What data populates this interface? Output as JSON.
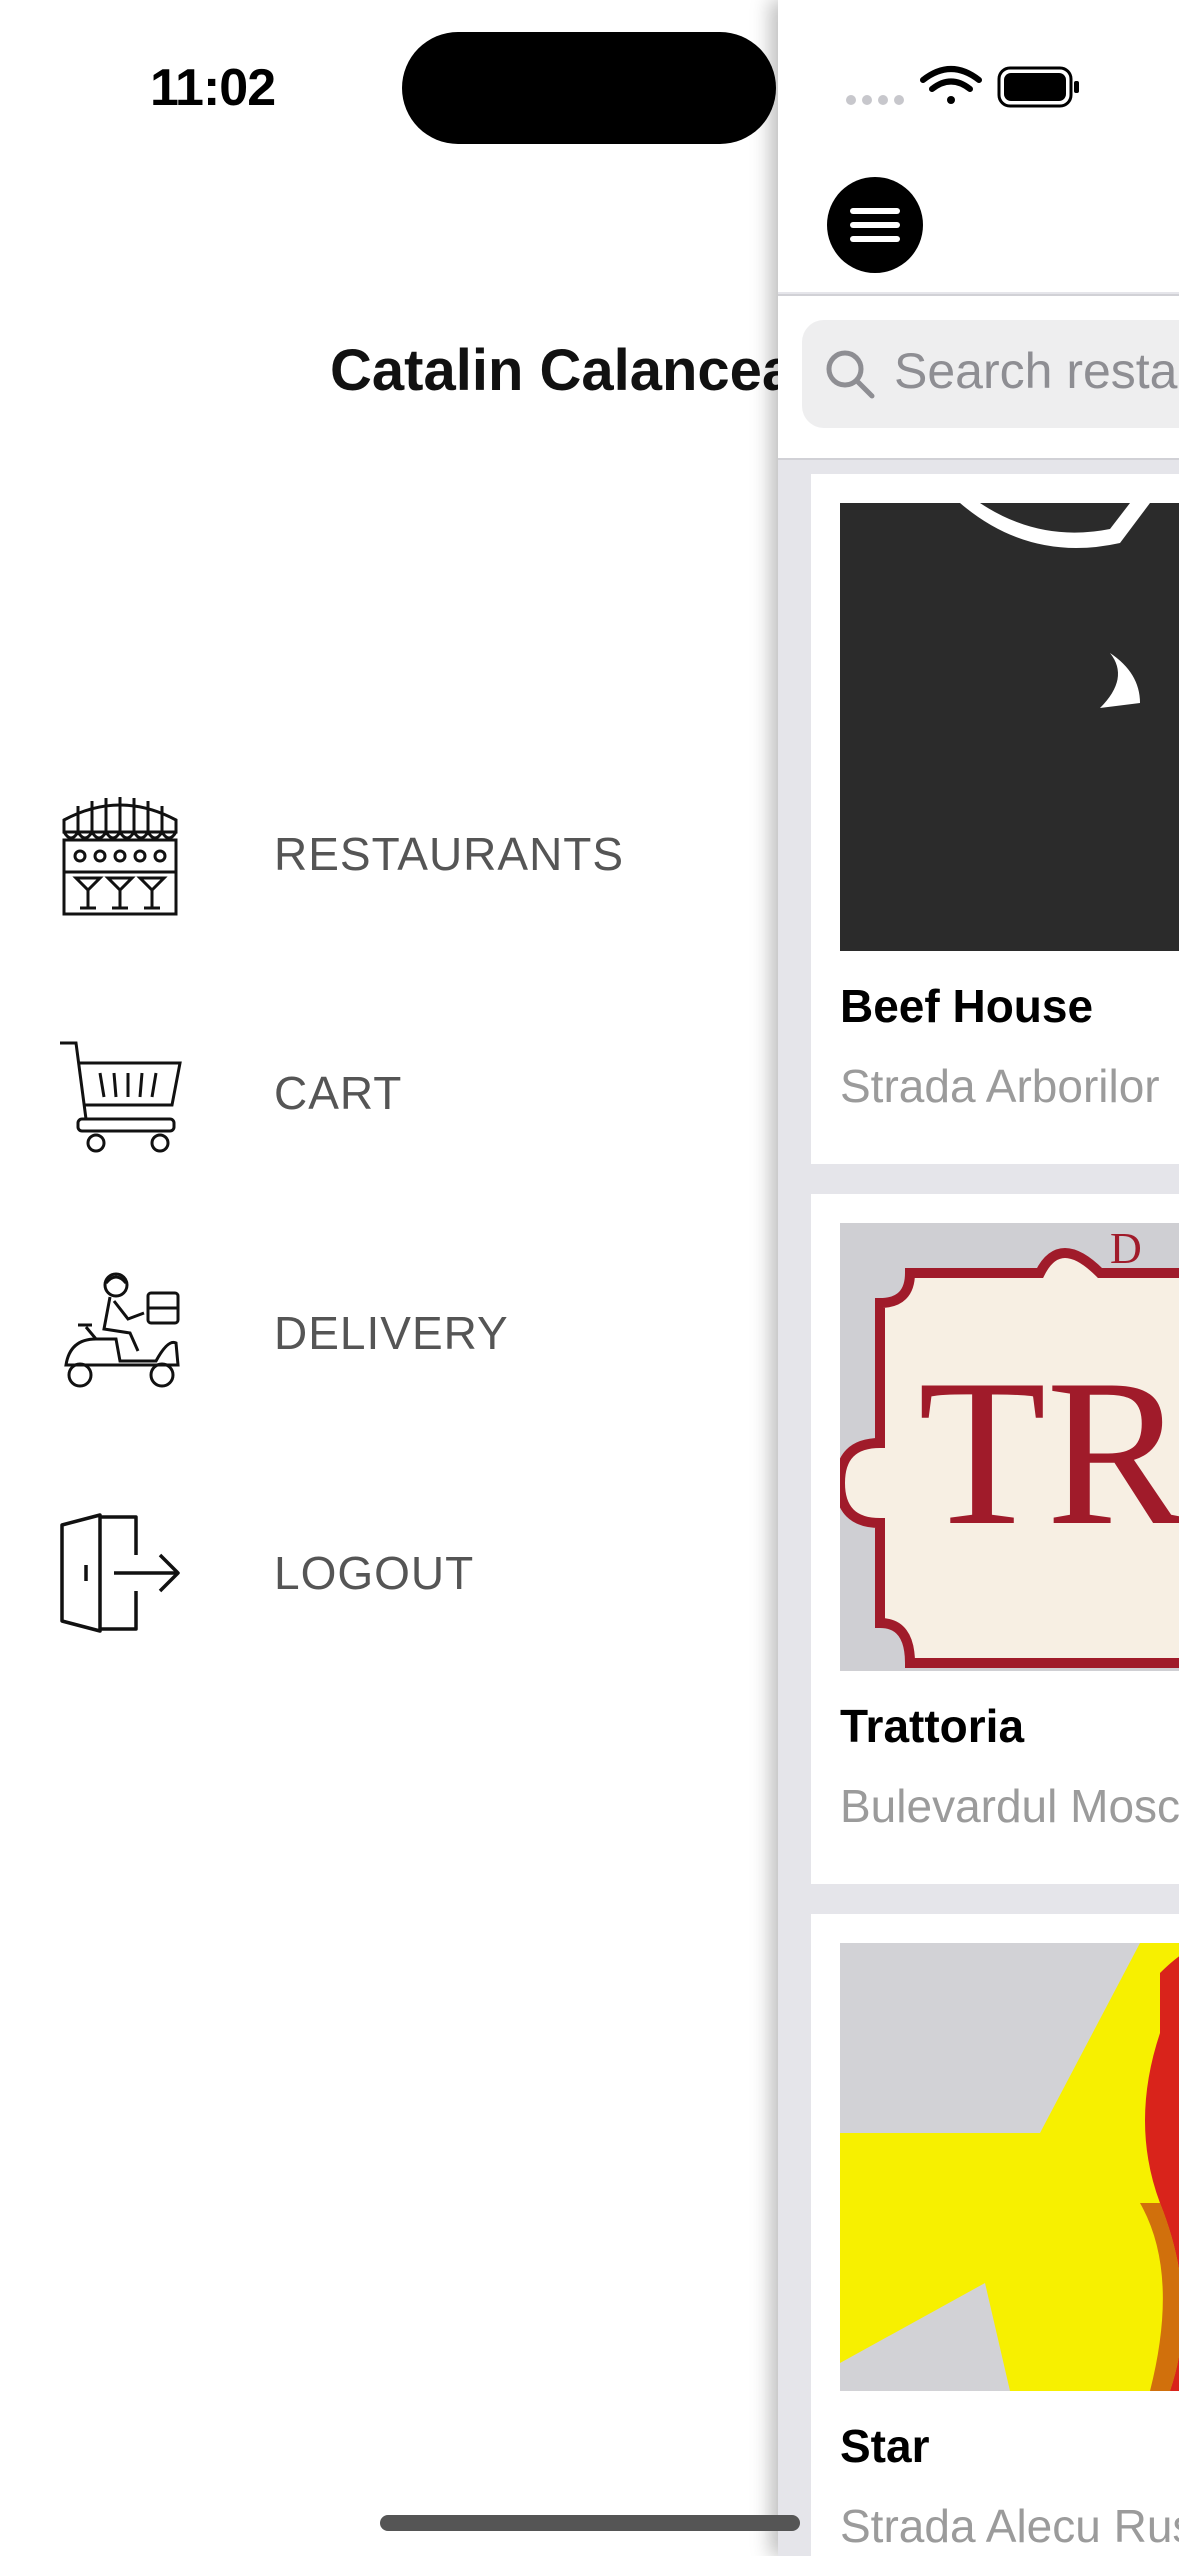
{
  "status_bar": {
    "time": "11:02",
    "signal_icon": "cellular-signal-icon",
    "wifi_icon": "wifi-icon",
    "battery_icon": "battery-icon"
  },
  "drawer": {
    "user_name": "Catalin Calancea",
    "items": [
      {
        "label": "RESTAURANTS",
        "icon": "restaurant-store-icon"
      },
      {
        "label": "CART",
        "icon": "shopping-cart-icon"
      },
      {
        "label": "DELIVERY",
        "icon": "delivery-scooter-icon"
      },
      {
        "label": "LOGOUT",
        "icon": "logout-door-icon"
      }
    ]
  },
  "main": {
    "menu_icon": "hamburger-menu-icon",
    "search": {
      "placeholder": "Search restaurants",
      "icon": "search-icon"
    },
    "restaurants": [
      {
        "name": "Beef House",
        "address": "Strada Arborilor",
        "logo_text": ""
      },
      {
        "name": "Trattoria",
        "address": "Bulevardul Moscova",
        "logo_text": "TRA"
      },
      {
        "name": "Star",
        "address": "Strada Alecu Russo",
        "logo_text": ""
      }
    ]
  },
  "colors": {
    "panel_background": "#e5e5ea",
    "trattoria_red": "#a01b2a",
    "star_yellow": "#f7f000",
    "star_red": "#d9231b"
  }
}
